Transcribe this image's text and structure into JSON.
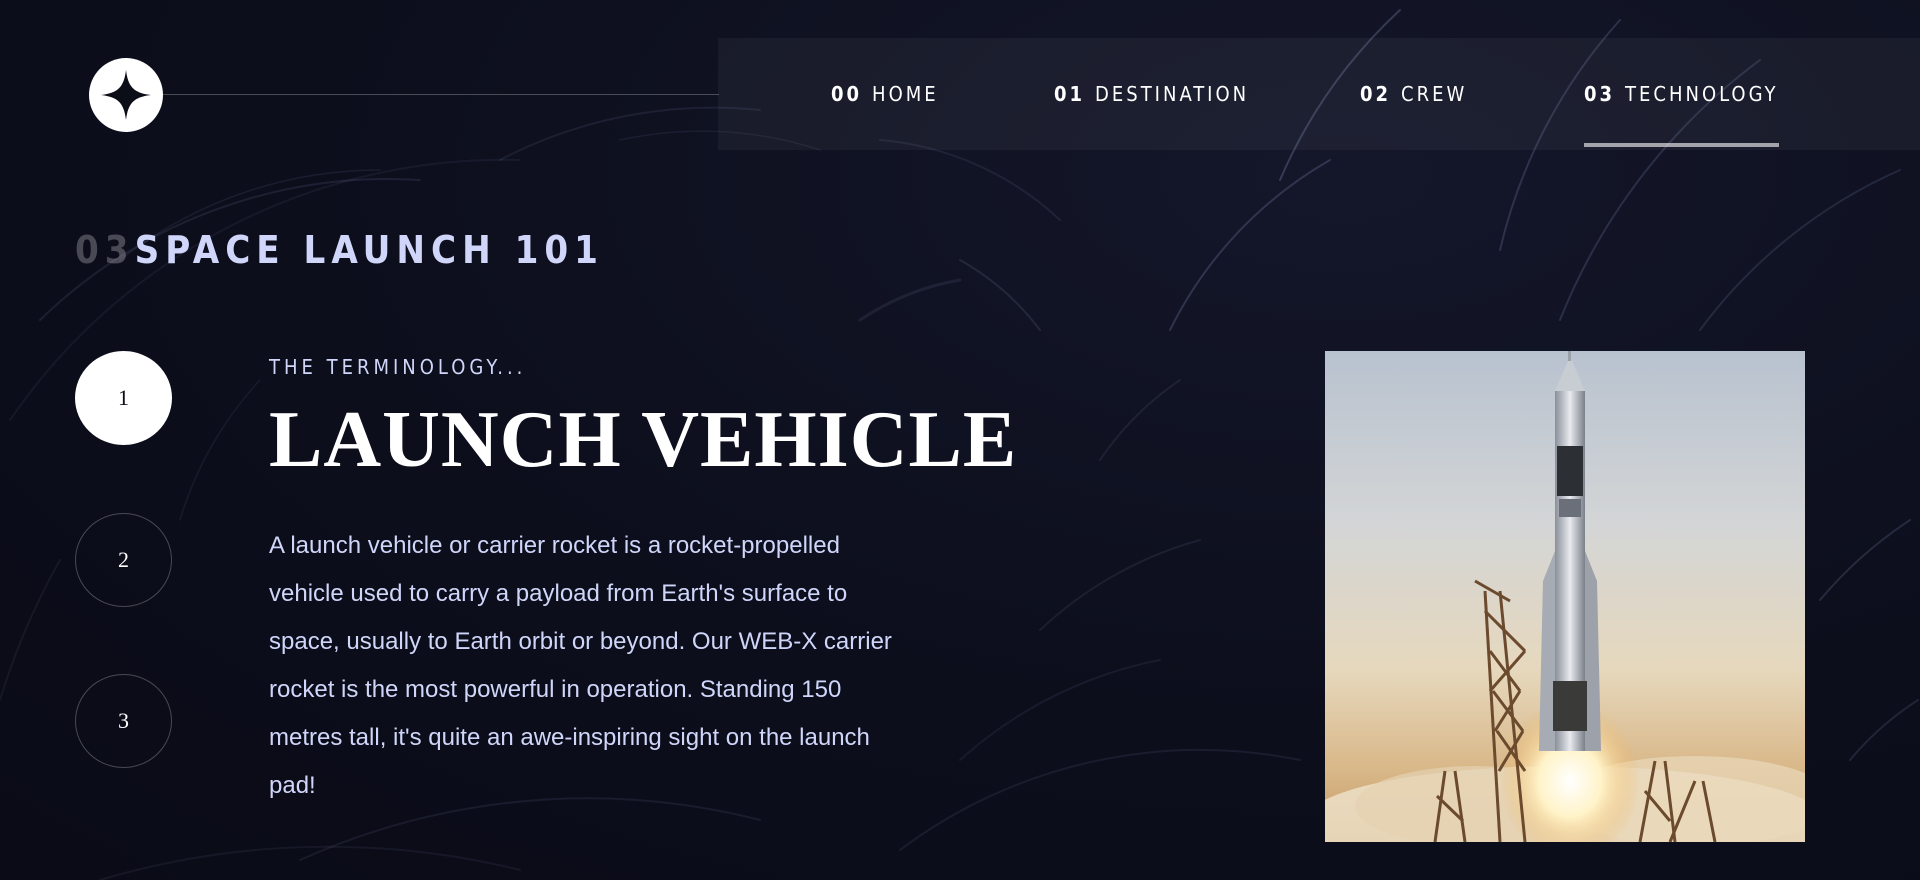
{
  "colors": {
    "background": "#0b0d17",
    "accent_text": "#d0d6f9",
    "white": "#ffffff"
  },
  "logo": {
    "icon": "four-point-star-icon"
  },
  "nav": {
    "items": [
      {
        "number": "00",
        "label": "HOME"
      },
      {
        "number": "01",
        "label": "DESTINATION"
      },
      {
        "number": "02",
        "label": "CREW"
      },
      {
        "number": "03",
        "label": "TECHNOLOGY",
        "active": true
      }
    ]
  },
  "page_heading": {
    "number": "03",
    "text": "SPACE LAUNCH 101"
  },
  "stepper": {
    "steps": [
      {
        "label": "1",
        "active": true
      },
      {
        "label": "2"
      },
      {
        "label": "3"
      }
    ]
  },
  "content": {
    "subheading": "THE TERMINOLOGY...",
    "title": "LAUNCH VEHICLE",
    "description": "A launch vehicle or carrier rocket is a rocket-propelled vehicle used to carry a payload from Earth's surface to space, usually to Earth orbit or beyond. Our WEB-X carrier rocket is the most powerful in operation. Standing 150 metres tall, it's quite an awe-inspiring sight on the launch pad!"
  },
  "image": {
    "subject": "rocket-launch-photo"
  }
}
